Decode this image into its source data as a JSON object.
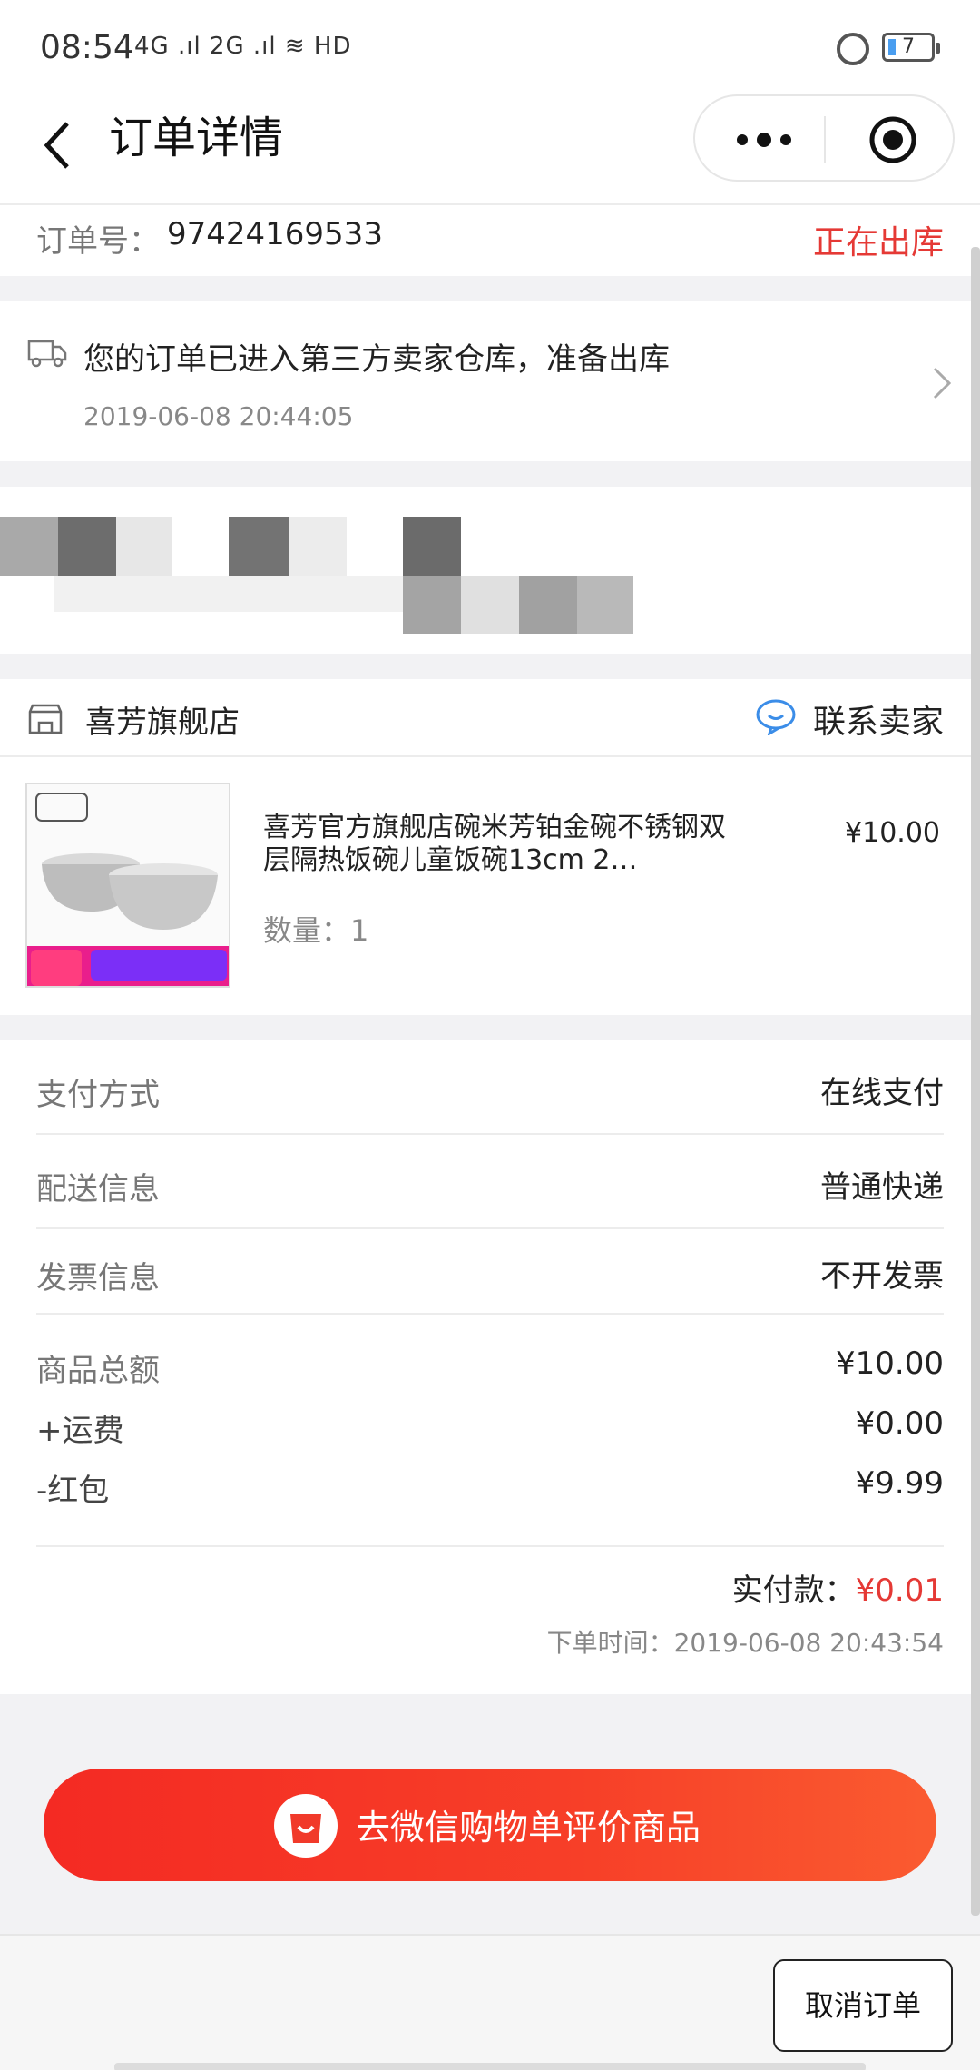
{
  "status_bar": {
    "time": "08:54",
    "signal": "4G .ıl 2G .ıl ≋ HD",
    "battery": "7"
  },
  "nav": {
    "title": "订单详情"
  },
  "order": {
    "number_label": "订单号：",
    "number": "97424169533",
    "status": "正在出库",
    "status_color": "#e53935"
  },
  "logistics": {
    "message": "您的订单已进入第三方卖家仓库，准备出库",
    "time": "2019-06-08 20:44:05"
  },
  "shop": {
    "name": "喜芳旗舰店",
    "contact_label": "联系卖家"
  },
  "product": {
    "title": "喜芳官方旗舰店碗米芳铂金碗不锈钢双层隔热饭碗儿童饭碗13cm 2…",
    "price": "¥10.00",
    "quantity_label": "数量：1"
  },
  "info": {
    "payment_label": "支付方式",
    "payment_value": "在线支付",
    "delivery_label": "配送信息",
    "delivery_value": "普通快递",
    "invoice_label": "发票信息",
    "invoice_value": "不开发票"
  },
  "summary": {
    "goods_total_label": "商品总额",
    "goods_total_value": "¥10.00",
    "shipping_label": "+运费",
    "shipping_value": "¥0.00",
    "red_packet_label": "-红包",
    "red_packet_value": "¥9.99",
    "paid_label": "实付款：",
    "paid_value": "¥0.01",
    "order_time_label": "下单时间：",
    "order_time": "2019-06-08 20:43:54"
  },
  "cta": {
    "label": "去微信购物单评价商品"
  },
  "bottom": {
    "cancel_label": "取消订单"
  },
  "colors": {
    "accent_red": "#e53935",
    "cta_start": "#f42a23",
    "cta_end": "#fa5b30"
  }
}
